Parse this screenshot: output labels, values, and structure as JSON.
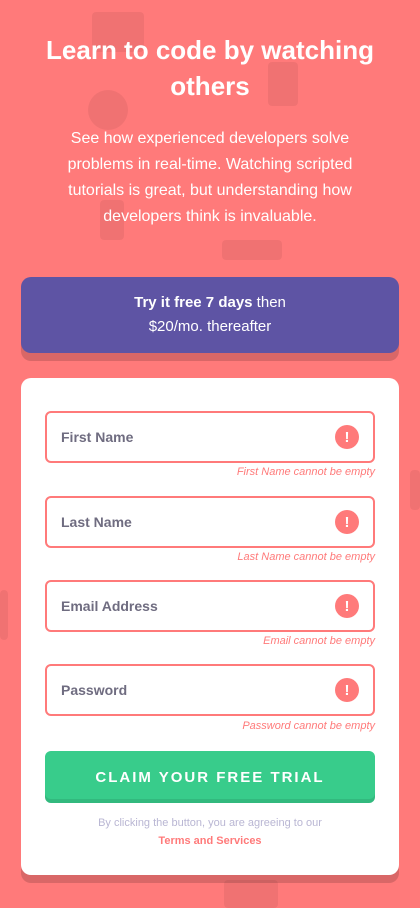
{
  "hero": {
    "title": "Learn to code by watching others",
    "description": "See how experienced developers solve problems in real-time. Watching scripted tutorials is great, but understanding how developers think is invaluable."
  },
  "offer": {
    "bold": "Try it free 7 days",
    "line1_rest": " then",
    "line2": "$20/mo. thereafter"
  },
  "form": {
    "fields": [
      {
        "placeholder": "First Name",
        "error": "First Name cannot be empty"
      },
      {
        "placeholder": "Last Name",
        "error": "Last Name cannot be empty"
      },
      {
        "placeholder": "Email Address",
        "error": "Email cannot be empty"
      },
      {
        "placeholder": "Password",
        "error": "Password cannot be empty"
      }
    ],
    "error_icon": "!",
    "submit_label": "CLAIM YOUR FREE TRIAL",
    "terms_text": "By clicking the button, you are agreeing to our",
    "terms_link": "Terms and Services"
  },
  "colors": {
    "background": "#ff7a7a",
    "accent_purple": "#5e54a4",
    "accent_green": "#38cc8b",
    "error": "#ff7a7a"
  }
}
